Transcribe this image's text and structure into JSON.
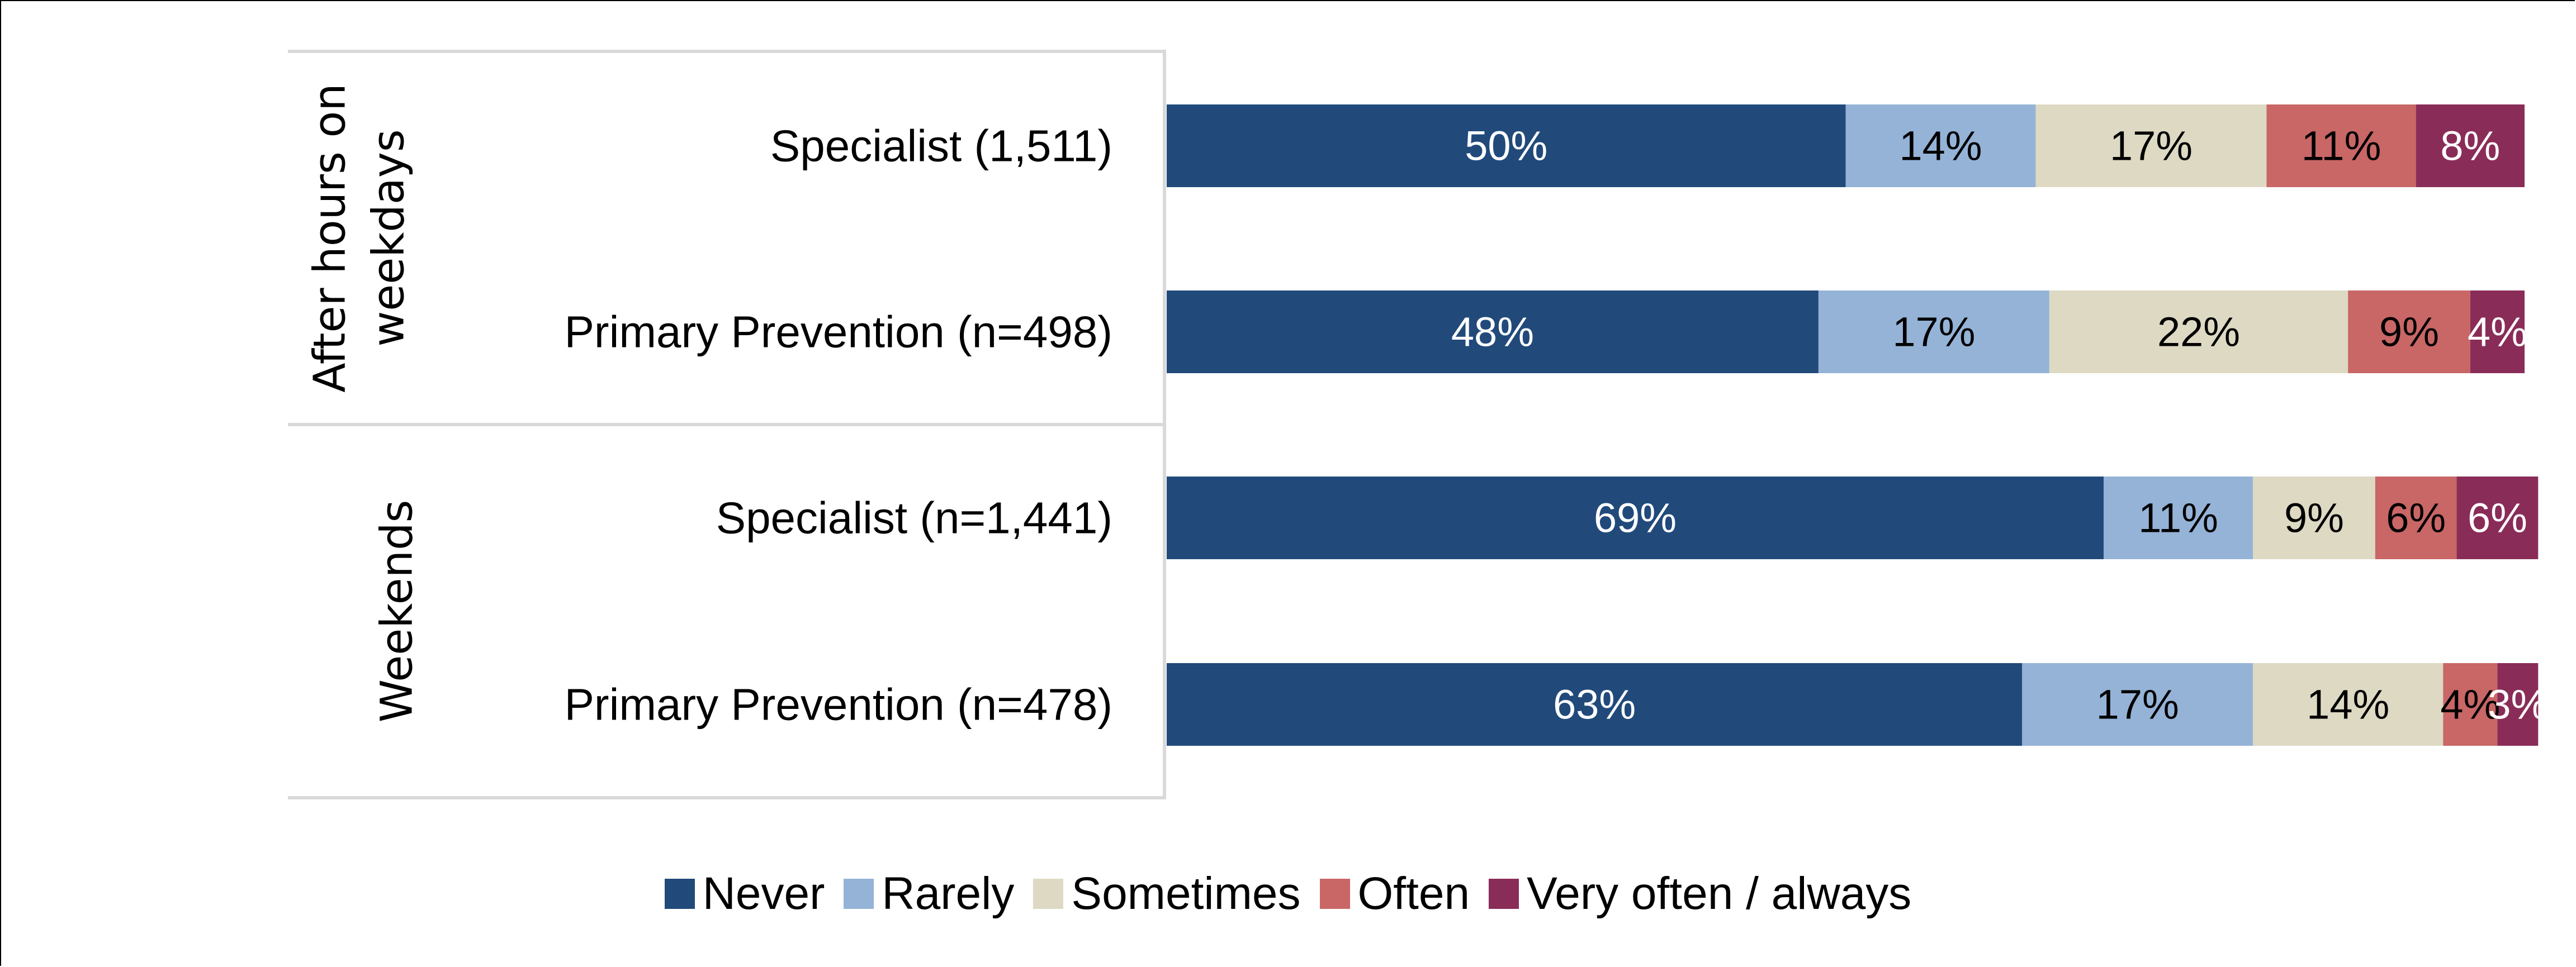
{
  "chart_data": {
    "type": "bar",
    "orientation": "horizontal",
    "stacked": true,
    "normalized_100": true,
    "title": "",
    "xlabel": "",
    "ylabel": "",
    "xlim": [
      0,
      100
    ],
    "grid": false,
    "legend_position": "bottom",
    "groups": [
      {
        "label": "After hours on weekdays",
        "label_lines": [
          "After hours on",
          "weekdays"
        ],
        "categories": [
          "Specialist (1,511)",
          "Primary Prevention (n=498)"
        ]
      },
      {
        "label": "Weekends",
        "label_lines": [
          "Weekends"
        ],
        "categories": [
          "Specialist (n=1,441)",
          "Primary Prevention (n=478)"
        ]
      }
    ],
    "categories": [
      "Specialist (1,511)",
      "Primary Prevention (n=498)",
      "Specialist (n=1,441)",
      "Primary Prevention (n=478)"
    ],
    "series": [
      {
        "name": "Never",
        "color": "#214a7b",
        "label_color": "#ffffff",
        "values": [
          50,
          48,
          69,
          63
        ]
      },
      {
        "name": "Rarely",
        "color": "#95b3d7",
        "label_color": "#000000",
        "values": [
          14,
          17,
          11,
          17
        ]
      },
      {
        "name": "Sometimes",
        "color": "#ddd9c3",
        "label_color": "#000000",
        "values": [
          17,
          22,
          9,
          14
        ]
      },
      {
        "name": "Often",
        "color": "#c96666",
        "label_color": "#000000",
        "values": [
          11,
          9,
          6,
          4
        ]
      },
      {
        "name": "Very often / always",
        "color": "#8a2c58",
        "label_color": "#ffffff",
        "values": [
          8,
          4,
          6,
          3
        ]
      }
    ],
    "value_format": "{v}%"
  },
  "legend": {
    "items": [
      {
        "label": "Never",
        "color": "#214a7b"
      },
      {
        "label": "Rarely",
        "color": "#95b3d7"
      },
      {
        "label": "Sometimes",
        "color": "#ddd9c3"
      },
      {
        "label": "Often",
        "color": "#c96666"
      },
      {
        "label": "Very often / always",
        "color": "#8a2c58"
      }
    ]
  },
  "colors": {
    "table_border": "#d9d9d9",
    "text": "#000000",
    "background": "#ffffff"
  }
}
